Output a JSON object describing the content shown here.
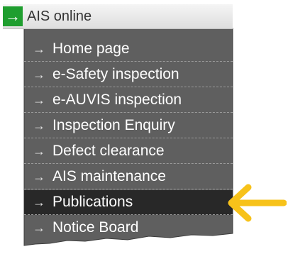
{
  "header": {
    "title": "AIS online",
    "icon": "arrow-right-icon",
    "icon_color": "#1f9e2f"
  },
  "menu": {
    "items": [
      {
        "label": "Home page"
      },
      {
        "label": "e-Safety inspection"
      },
      {
        "label": "e-AUVIS inspection"
      },
      {
        "label": "Inspection Enquiry"
      },
      {
        "label": "Defect clearance"
      },
      {
        "label": "AIS maintenance"
      },
      {
        "label": "Publications",
        "active": true
      },
      {
        "label": "Notice Board"
      }
    ],
    "background": "#5f5f5f",
    "active_background": "#282828"
  },
  "callout": {
    "icon": "arrow-left-icon",
    "color": "#f7c21a"
  }
}
